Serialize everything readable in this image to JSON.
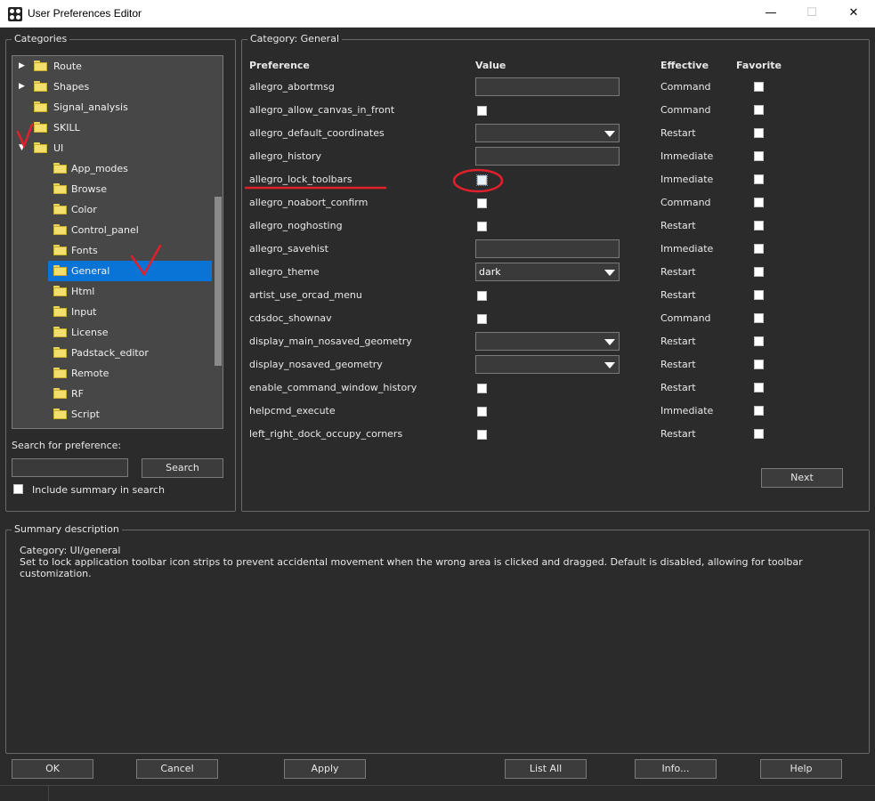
{
  "window": {
    "title": "User Preferences Editor",
    "minimize": "—",
    "maximize": "☐",
    "close": "✕"
  },
  "categories": {
    "title": "Categories",
    "tree": [
      {
        "label": "Route",
        "expander": "▶"
      },
      {
        "label": "Shapes",
        "expander": "▶"
      },
      {
        "label": "Signal_analysis",
        "expander": ""
      },
      {
        "label": "SKILL",
        "expander": ""
      },
      {
        "label": "UI",
        "expander": "▼"
      },
      {
        "label": "App_modes"
      },
      {
        "label": "Browse"
      },
      {
        "label": "Color"
      },
      {
        "label": "Control_panel"
      },
      {
        "label": "Fonts"
      },
      {
        "label": "General",
        "selected": true
      },
      {
        "label": "Html"
      },
      {
        "label": "Input"
      },
      {
        "label": "License"
      },
      {
        "label": "Padstack_editor"
      },
      {
        "label": "Remote"
      },
      {
        "label": "RF"
      },
      {
        "label": "Script"
      }
    ],
    "search_label": "Search for preference:",
    "search_value": "",
    "search_button": "Search",
    "include_summary_label": "Include summary in search"
  },
  "grid": {
    "title": "Category:  General",
    "headers": {
      "preference": "Preference",
      "value": "Value",
      "effective": "Effective",
      "favorite": "Favorite"
    },
    "rows": [
      {
        "name": "allegro_abortmsg",
        "control": "text",
        "value": "",
        "effective": "Command"
      },
      {
        "name": "allegro_allow_canvas_in_front",
        "control": "check",
        "effective": "Command"
      },
      {
        "name": "allegro_default_coordinates",
        "control": "combo",
        "value": "",
        "effective": "Restart"
      },
      {
        "name": "allegro_history",
        "control": "text",
        "value": "",
        "effective": "Immediate"
      },
      {
        "name": "allegro_lock_toolbars",
        "control": "check",
        "effective": "Immediate",
        "focused": true
      },
      {
        "name": "allegro_noabort_confirm",
        "control": "check",
        "effective": "Command"
      },
      {
        "name": "allegro_noghosting",
        "control": "check",
        "effective": "Restart"
      },
      {
        "name": "allegro_savehist",
        "control": "text",
        "value": "",
        "effective": "Immediate"
      },
      {
        "name": "allegro_theme",
        "control": "combo",
        "value": "dark",
        "effective": "Restart"
      },
      {
        "name": "artist_use_orcad_menu",
        "control": "check",
        "effective": "Restart"
      },
      {
        "name": "cdsdoc_shownav",
        "control": "check",
        "effective": "Command"
      },
      {
        "name": "display_main_nosaved_geometry",
        "control": "combo",
        "value": "",
        "effective": "Restart"
      },
      {
        "name": "display_nosaved_geometry",
        "control": "combo",
        "value": "",
        "effective": "Restart"
      },
      {
        "name": "enable_command_window_history",
        "control": "check",
        "effective": "Restart"
      },
      {
        "name": "helpcmd_execute",
        "control": "check",
        "effective": "Immediate"
      },
      {
        "name": "left_right_dock_occupy_corners",
        "control": "check",
        "effective": "Restart"
      }
    ],
    "next_button": "Next"
  },
  "summary": {
    "title": "Summary description",
    "line1": "Category: UI/general",
    "line2": "Set to lock application toolbar icon strips to prevent accidental movement when the wrong area is clicked and dragged. Default is disabled, allowing for toolbar customization."
  },
  "buttons": {
    "ok": "OK",
    "cancel": "Cancel",
    "apply": "Apply",
    "list_all": "List All",
    "info": "Info...",
    "help": "Help"
  },
  "colors": {
    "background": "#2b2b2b",
    "selection": "#0a74d6",
    "annotation": "#e0202a"
  }
}
